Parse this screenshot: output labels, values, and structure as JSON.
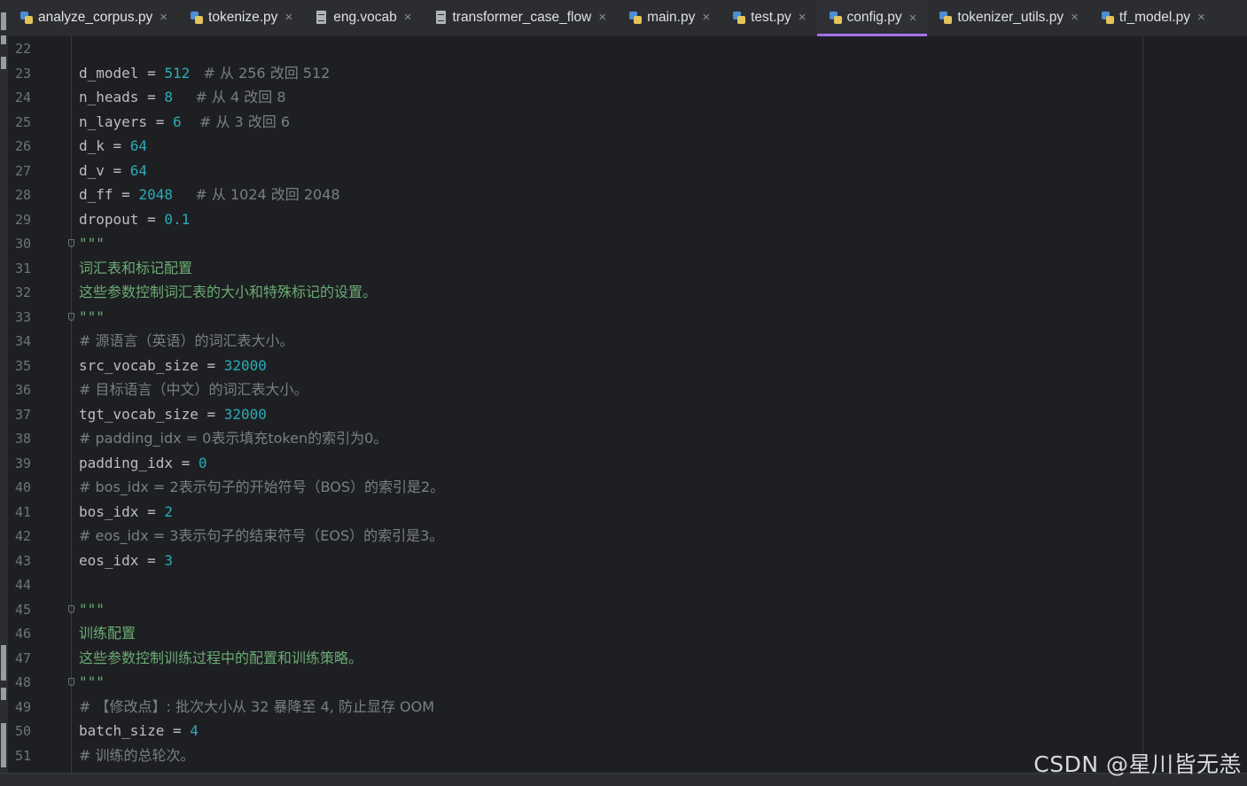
{
  "tabs": [
    {
      "label": "analyze_corpus.py",
      "icon": "python-file-icon",
      "active": false
    },
    {
      "label": "tokenize.py",
      "icon": "python-file-icon",
      "active": false
    },
    {
      "label": "eng.vocab",
      "icon": "text-file-icon",
      "active": false
    },
    {
      "label": "transformer_case_flow",
      "icon": "text-file-icon",
      "active": false
    },
    {
      "label": "main.py",
      "icon": "python-file-icon",
      "active": false
    },
    {
      "label": "test.py",
      "icon": "python-file-icon",
      "active": false
    },
    {
      "label": "config.py",
      "icon": "python-file-icon",
      "active": true
    },
    {
      "label": "tokenizer_utils.py",
      "icon": "python-file-icon",
      "active": false
    },
    {
      "label": "tf_model.py",
      "icon": "python-file-icon",
      "active": false
    }
  ],
  "close_glyph": "×",
  "editor": {
    "lines": [
      {
        "n": "22",
        "parts": []
      },
      {
        "n": "23",
        "parts": [
          {
            "t": "d_model = ",
            "c": "kw"
          },
          {
            "t": "512",
            "c": "num"
          },
          {
            "t": "   # 从 256 改回 512",
            "c": "cmt"
          }
        ]
      },
      {
        "n": "24",
        "parts": [
          {
            "t": "n_heads = ",
            "c": "kw"
          },
          {
            "t": "8",
            "c": "num"
          },
          {
            "t": "     # 从 4 改回 8",
            "c": "cmt"
          }
        ]
      },
      {
        "n": "25",
        "parts": [
          {
            "t": "n_layers = ",
            "c": "kw"
          },
          {
            "t": "6",
            "c": "num"
          },
          {
            "t": "    # 从 3 改回 6",
            "c": "cmt"
          }
        ]
      },
      {
        "n": "26",
        "parts": [
          {
            "t": "d_k = ",
            "c": "kw"
          },
          {
            "t": "64",
            "c": "num"
          }
        ]
      },
      {
        "n": "27",
        "parts": [
          {
            "t": "d_v = ",
            "c": "kw"
          },
          {
            "t": "64",
            "c": "num"
          }
        ]
      },
      {
        "n": "28",
        "parts": [
          {
            "t": "d_ff = ",
            "c": "kw"
          },
          {
            "t": "2048",
            "c": "num"
          },
          {
            "t": "     # 从 1024 改回 2048",
            "c": "cmt"
          }
        ]
      },
      {
        "n": "29",
        "parts": [
          {
            "t": "dropout = ",
            "c": "kw"
          },
          {
            "t": "0.1",
            "c": "num"
          }
        ]
      },
      {
        "n": "30",
        "parts": [
          {
            "t": "\"\"\"",
            "c": "doc"
          }
        ],
        "fold": true
      },
      {
        "n": "31",
        "parts": [
          {
            "t": "词汇表和标记配置",
            "c": "doc"
          }
        ]
      },
      {
        "n": "32",
        "parts": [
          {
            "t": "这些参数控制词汇表的大小和特殊标记的设置。",
            "c": "doc"
          }
        ]
      },
      {
        "n": "33",
        "parts": [
          {
            "t": "\"\"\"",
            "c": "doc"
          }
        ],
        "fold": true
      },
      {
        "n": "34",
        "parts": [
          {
            "t": "# 源语言（英语）的词汇表大小。",
            "c": "cmt"
          }
        ]
      },
      {
        "n": "35",
        "parts": [
          {
            "t": "src_vocab_size = ",
            "c": "kw"
          },
          {
            "t": "32000",
            "c": "num"
          }
        ]
      },
      {
        "n": "36",
        "parts": [
          {
            "t": "# 目标语言（中文）的词汇表大小。",
            "c": "cmt"
          }
        ]
      },
      {
        "n": "37",
        "parts": [
          {
            "t": "tgt_vocab_size = ",
            "c": "kw"
          },
          {
            "t": "32000",
            "c": "num"
          }
        ]
      },
      {
        "n": "38",
        "parts": [
          {
            "t": "# padding_idx = 0表示填充token的索引为0。",
            "c": "cmt"
          }
        ]
      },
      {
        "n": "39",
        "parts": [
          {
            "t": "padding_idx = ",
            "c": "kw"
          },
          {
            "t": "0",
            "c": "num"
          }
        ]
      },
      {
        "n": "40",
        "parts": [
          {
            "t": "# bos_idx = 2表示句子的开始符号（BOS）的索引是2。",
            "c": "cmt"
          }
        ]
      },
      {
        "n": "41",
        "parts": [
          {
            "t": "bos_idx = ",
            "c": "kw"
          },
          {
            "t": "2",
            "c": "num"
          }
        ]
      },
      {
        "n": "42",
        "parts": [
          {
            "t": "# eos_idx = 3表示句子的结束符号（EOS）的索引是3。",
            "c": "cmt"
          }
        ]
      },
      {
        "n": "43",
        "parts": [
          {
            "t": "eos_idx = ",
            "c": "kw"
          },
          {
            "t": "3",
            "c": "num"
          }
        ]
      },
      {
        "n": "44",
        "parts": []
      },
      {
        "n": "45",
        "parts": [
          {
            "t": "\"\"\"",
            "c": "doc"
          }
        ],
        "fold": true
      },
      {
        "n": "46",
        "parts": [
          {
            "t": "训练配置",
            "c": "doc"
          }
        ]
      },
      {
        "n": "47",
        "parts": [
          {
            "t": "这些参数控制训练过程中的配置和训练策略。",
            "c": "doc"
          }
        ]
      },
      {
        "n": "48",
        "parts": [
          {
            "t": "\"\"\"",
            "c": "doc"
          }
        ],
        "fold": true
      },
      {
        "n": "49",
        "parts": [
          {
            "t": "# 【修改点】: 批次大小从 32 暴降至 4, 防止显存 OOM",
            "c": "cmt"
          }
        ]
      },
      {
        "n": "50",
        "parts": [
          {
            "t": "batch_size = ",
            "c": "kw"
          },
          {
            "t": "4",
            "c": "num"
          }
        ]
      },
      {
        "n": "51",
        "parts": [
          {
            "t": "# 训练的总轮次。",
            "c": "cmt"
          }
        ]
      }
    ]
  },
  "watermark": "CSDN @星川皆无恙"
}
